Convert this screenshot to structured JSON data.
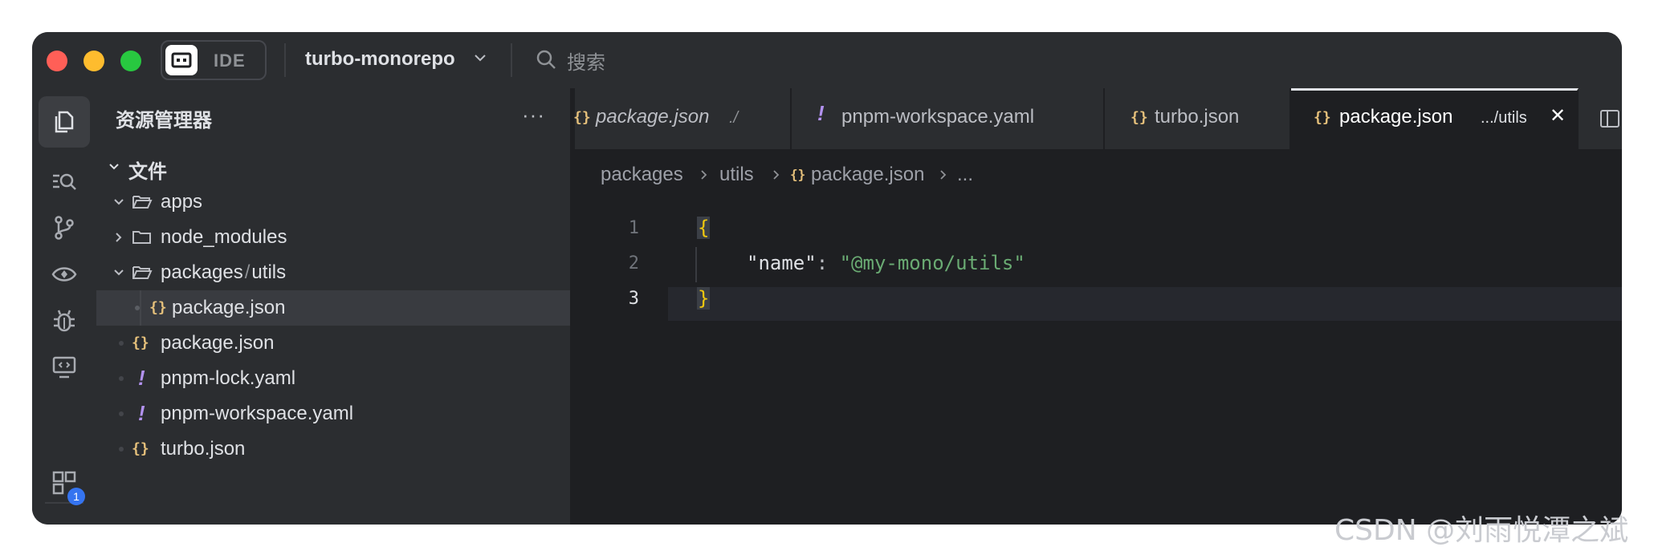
{
  "titlebar": {
    "ide_label": "IDE",
    "project_name": "turbo-monorepo",
    "search_label": "搜索"
  },
  "activity_bar": {
    "items": [
      "explorer-icon",
      "search-files-icon",
      "source-control-icon",
      "preview-icon",
      "debug-icon",
      "remote-icon",
      "extensions-icon"
    ],
    "extensions_badge": "1"
  },
  "explorer": {
    "title": "资源管理器",
    "more": "···",
    "section": "文件",
    "tree": {
      "apps": "apps",
      "node_modules": "node_modules",
      "packages": "packages",
      "utils": "utils",
      "utils_package": "package.json",
      "root_package": "package.json",
      "pnpm_lock": "pnpm-lock.yaml",
      "pnpm_workspace": "pnpm-workspace.yaml",
      "turbo": "turbo.json"
    }
  },
  "tabs": [
    {
      "label": "package.json",
      "hint": "./"
    },
    {
      "label": "pnpm-workspace.yaml"
    },
    {
      "label": "turbo.json"
    },
    {
      "label": "package.json",
      "hint": ".../utils"
    }
  ],
  "breadcrumb": [
    "packages",
    "utils",
    "package.json",
    "..."
  ],
  "editor": {
    "line_numbers": [
      "1",
      "2",
      "3"
    ],
    "line1": "{",
    "line2_key": "\"name\"",
    "line2_colon": ": ",
    "line2_value": "\"@my-mono/utils\"",
    "line3": "}"
  },
  "colors": {
    "window_bg": "#1e1f22",
    "panel_bg": "#2b2d30",
    "json_icon": "#e5c07b",
    "yaml_icon": "#b392f0",
    "string": "#6aab73",
    "brace": "#f1c80f"
  },
  "watermark": "CSDN @刘雨悦潭之斌"
}
